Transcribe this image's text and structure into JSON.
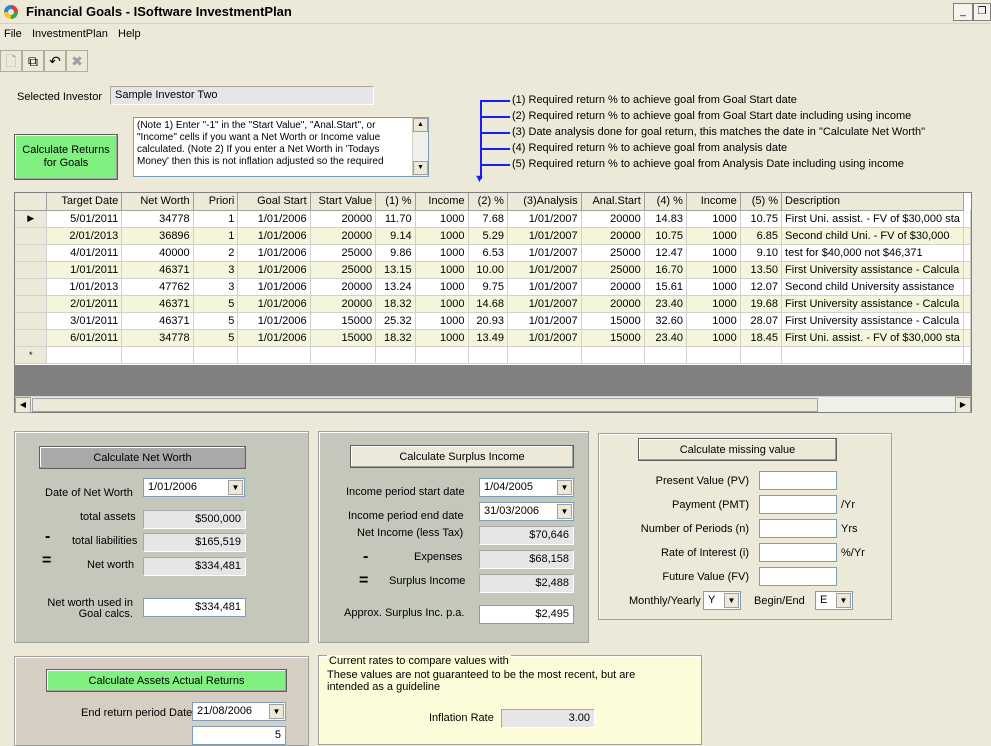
{
  "window": {
    "title": "Financial Goals - ISoftware InvestmentPlan",
    "minimize": "_",
    "restore": "❐"
  },
  "menu": {
    "file": "File",
    "investmentplan": "InvestmentPlan",
    "help": "Help"
  },
  "toolbar": {
    "new_icon": "🗋",
    "copy_icon": "⧉",
    "undo_icon": "↶",
    "delete_icon": "✖"
  },
  "investor": {
    "label": "Selected Investor",
    "value": "Sample Investor Two"
  },
  "calc_goals_button": "Calculate Returns for Goals",
  "notes": "(Note 1) Enter \"-1\" in the \"Start Value\", \"Anal.Start\", or \"Income\" cells if you want a Net Worth or Income value calculated. (Note 2) If you enter a Net Worth in 'Todays Money' then this is not inflation adjusted so the required",
  "legend": [
    "(1) Required return % to achieve goal from Goal Start date",
    "(2) Required return % to achieve goal from Goal Start date including using income",
    "(3) Date analysis done for goal return, this matches the date in \"Calculate Net Worth\"",
    "(4) Required return % to achieve goal from analysis date",
    "(5) Required return % to achieve goal from Analysis Date including using income"
  ],
  "grid": {
    "columns": [
      "Target Date",
      "Net Worth",
      "Priori",
      "Goal Start",
      "Start Value",
      "(1) %",
      "Income",
      "(2) %",
      "(3)Analysis",
      "Anal.Start",
      "(4) %",
      "Income",
      "(5) %",
      "Description"
    ],
    "rows": [
      [
        "5/01/2011",
        "34778",
        "1",
        "1/01/2006",
        "20000",
        "11.70",
        "1000",
        "7.68",
        "1/01/2007",
        "20000",
        "14.83",
        "1000",
        "10.75",
        "First Uni. assist. - FV of $30,000 sta"
      ],
      [
        "2/01/2013",
        "36896",
        "1",
        "1/01/2006",
        "20000",
        "9.14",
        "1000",
        "5.29",
        "1/01/2007",
        "20000",
        "10.75",
        "1000",
        "6.85",
        "Second child Uni. - FV of $30,000"
      ],
      [
        "4/01/2011",
        "40000",
        "2",
        "1/01/2006",
        "25000",
        "9.86",
        "1000",
        "6.53",
        "1/01/2007",
        "25000",
        "12.47",
        "1000",
        "9.10",
        "test for $40,000 not $46,371"
      ],
      [
        "1/01/2011",
        "46371",
        "3",
        "1/01/2006",
        "25000",
        "13.15",
        "1000",
        "10.00",
        "1/01/2007",
        "25000",
        "16.70",
        "1000",
        "13.50",
        "First University assistance - Calcula"
      ],
      [
        "1/01/2013",
        "47762",
        "3",
        "1/01/2006",
        "20000",
        "13.24",
        "1000",
        "9.75",
        "1/01/2007",
        "20000",
        "15.61",
        "1000",
        "12.07",
        "Second child University assistance"
      ],
      [
        "2/01/2011",
        "46371",
        "5",
        "1/01/2006",
        "20000",
        "18.32",
        "1000",
        "14.68",
        "1/01/2007",
        "20000",
        "23.40",
        "1000",
        "19.68",
        "First University assistance - Calcula"
      ],
      [
        "3/01/2011",
        "46371",
        "5",
        "1/01/2006",
        "15000",
        "25.32",
        "1000",
        "20.93",
        "1/01/2007",
        "15000",
        "32.60",
        "1000",
        "28.07",
        "First University assistance - Calcula"
      ],
      [
        "6/01/2011",
        "34778",
        "5",
        "1/01/2006",
        "15000",
        "18.32",
        "1000",
        "13.49",
        "1/01/2007",
        "15000",
        "23.40",
        "1000",
        "18.45",
        "First Uni. assist. - FV of $30,000 sta"
      ]
    ],
    "new_row_marker": "*",
    "current_row_marker": "▶"
  },
  "net_worth": {
    "button": "Calculate Net Worth",
    "date_label": "Date of Net Worth",
    "date_value": "1/01/2006",
    "assets_label": "total assets",
    "assets_value": "$500,000",
    "liabilities_label": "total liabilities",
    "liabilities_value": "$165,519",
    "networth_label": "Net worth",
    "networth_value": "$334,481",
    "used_label": "Net worth used in Goal calcs.",
    "used_value": "$334,481"
  },
  "surplus": {
    "button": "Calculate Surplus Income",
    "start_label": "Income period start date",
    "start_value": "1/04/2005",
    "end_label": "Income period end date",
    "end_value": "31/03/2006",
    "net_label": "Net Income (less Tax)",
    "net_value": "$70,646",
    "expenses_label": "Expenses",
    "expenses_value": "$68,158",
    "surplus_label": "Surplus Income",
    "surplus_value": "$2,488",
    "approx_label": "Approx. Surplus Inc. p.a.",
    "approx_value": "$2,495"
  },
  "missing": {
    "button": "Calculate missing value",
    "pv_label": "Present Value (PV)",
    "pmt_label": "Payment (PMT)",
    "pmt_unit": "/Yr",
    "n_label": "Number of Periods (n)",
    "n_unit": "Yrs",
    "i_label": "Rate of Interest (i)",
    "i_unit": "%/Yr",
    "fv_label": "Future Value (FV)",
    "freq_label": "Monthly/Yearly",
    "freq_value": "Y",
    "begin_label": "Begin/End",
    "begin_value": "E"
  },
  "assets_returns": {
    "button": "Calculate Assets Actual Returns",
    "end_label": "End return period Date",
    "end_value": "21/08/2006",
    "next_value": "5"
  },
  "rates": {
    "title": "Current rates to compare values with",
    "note": "These values are not guaranteed to be the most recent, but are intended as a guideline",
    "inflation_label": "Inflation Rate",
    "inflation_value": "3.00"
  },
  "ops": {
    "minus": "-",
    "equals": "="
  }
}
